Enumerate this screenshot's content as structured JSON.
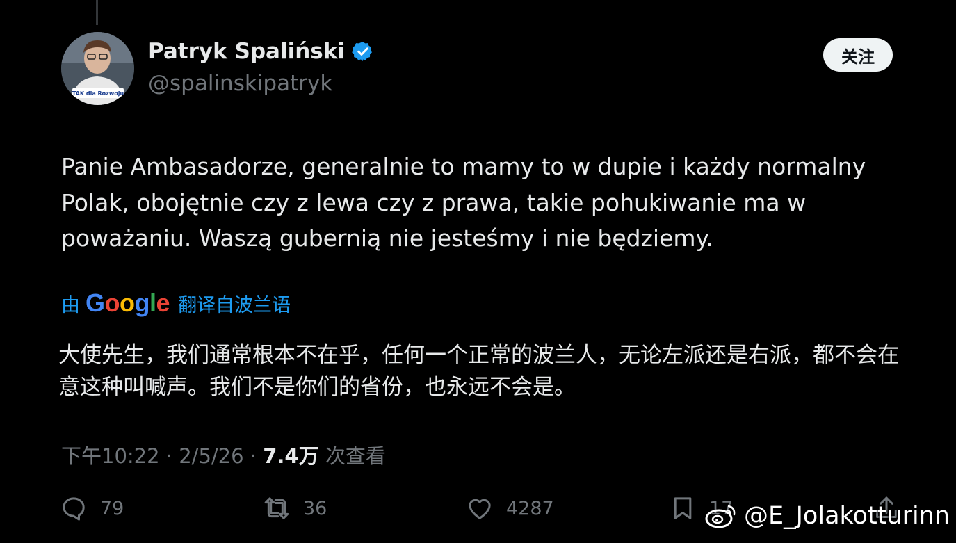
{
  "author": {
    "name": "Patryk Spaliński",
    "handle": "@spalinskipatryk",
    "avatar_shirt_text": "TAK dla Rozwoju"
  },
  "header": {
    "follow_label": "关注"
  },
  "tweet": {
    "text": "Panie Ambasadorze, generalnie to mamy to w dupie i każdy normalny Polak, obojętnie czy z lewa czy z prawa, takie pohukiwanie ma w poważaniu. Waszą gubernią nie jesteśmy i nie będziemy."
  },
  "translation": {
    "by_label": "由",
    "provider": "Google",
    "label": "翻译自波兰语",
    "text": "大使先生，我们通常根本不在乎，任何一个正常的波兰人，无论左派还是右派，都不会在意这种叫喊声。我们不是你们的省份，也永远不会是。"
  },
  "meta": {
    "time": "下午10:22",
    "sep1": " · ",
    "date": "2/5/26",
    "sep2": " · ",
    "views": "7.4万",
    "views_label": " 次查看"
  },
  "actions": {
    "replies": "79",
    "reposts": "36",
    "likes": "4287",
    "bookmarks": "17"
  },
  "watermark": {
    "text": "@E_Jolakotturinn",
    "icon": "weibo-icon"
  },
  "colors": {
    "background": "#000000",
    "text": "#e7e9ea",
    "secondary": "#71767b",
    "link": "#1d9bf0",
    "verified": "#1d9bf0"
  }
}
